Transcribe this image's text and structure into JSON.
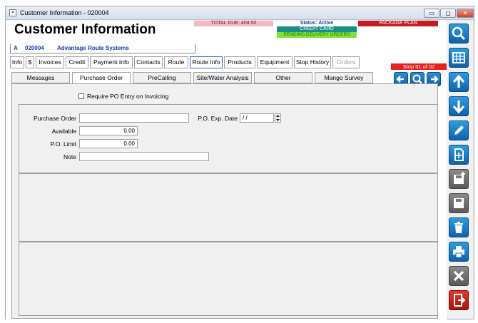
{
  "window": {
    "title": "Customer Information - 020004",
    "close_glyph": "✕",
    "minimize_glyph": "▭",
    "maximize_glyph": "▢"
  },
  "header": {
    "title": "Customer Information",
    "account_code": "A",
    "account_number": "020004",
    "account_name": "Advantage Route Systems",
    "total_due": "TOTAL DUE: 404.50",
    "status": "Status: Active",
    "payment_method": "CREDIT CARD",
    "package_plan": "PACKAGE PLAN",
    "pending_orders": "PENDING DELIVERY ORDERS"
  },
  "colors": {
    "total_due_bg": "#f5b8c4",
    "status_text": "#1a3aa8",
    "credit_card_bg": "#1a8f88",
    "package_plan_bg": "#c41a22",
    "pending_bg": "#7fe03a",
    "nav_blue": "#1a78c8",
    "stop_red": "#e8201e"
  },
  "tabs_primary": [
    {
      "label": "Info"
    },
    {
      "label": "$"
    },
    {
      "label": "Invoices"
    },
    {
      "label": "Credit"
    },
    {
      "label": "Payment Info"
    },
    {
      "label": "Contacts"
    },
    {
      "label": "Route"
    },
    {
      "label": "Route Info"
    },
    {
      "label": "Products"
    },
    {
      "label": "Equipment"
    },
    {
      "label": "Stop History"
    },
    {
      "label": "Orders"
    }
  ],
  "tabs_secondary": [
    {
      "label": "Messages"
    },
    {
      "label": "Purchase Order"
    },
    {
      "label": "PreCalling"
    },
    {
      "label": "Site/Water Analysis"
    },
    {
      "label": "Other"
    },
    {
      "label": "Mango Survey"
    }
  ],
  "stop_indicator": "Stop  01  of  02",
  "form": {
    "require_po_label": "Require PO Entry on Invoicing",
    "purchase_order_label": "Purchase Order",
    "purchase_order_value": "",
    "available_label": "Available",
    "available_value": "0.00",
    "po_limit_label": "P.O. Limit",
    "po_limit_value": "0.00",
    "note_label": "Note",
    "note_value": "",
    "po_exp_date_label": "P.O. Exp. Date",
    "po_exp_date_value": " / /"
  },
  "sidebar_icons": [
    "search-icon",
    "grid-icon",
    "arrow-up-icon",
    "arrow-down-icon",
    "pencil-icon",
    "new-document-icon",
    "disk-new-icon",
    "disk-icon",
    "trash-icon",
    "print-icon",
    "close-x-icon",
    "exit-icon"
  ]
}
